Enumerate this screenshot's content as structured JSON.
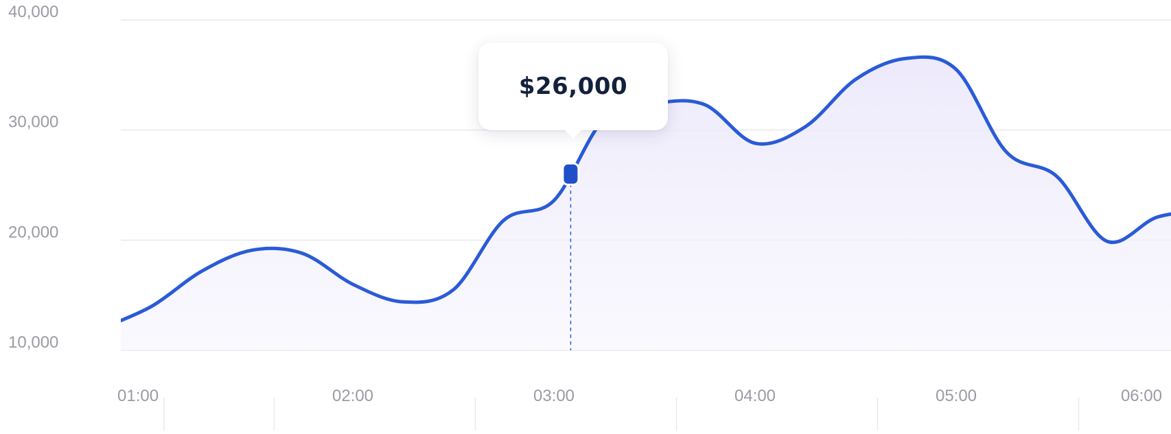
{
  "chart_data": {
    "type": "area",
    "x": [
      "00:45",
      "01:00",
      "01:15",
      "01:30",
      "01:45",
      "02:00",
      "02:15",
      "02:30",
      "02:45",
      "03:00",
      "03:15",
      "03:30",
      "03:45",
      "04:00",
      "04:15",
      "04:30",
      "04:45",
      "05:00",
      "05:15",
      "05:30",
      "05:45",
      "06:00",
      "06:15"
    ],
    "series": [
      {
        "values": [
          12000,
          14000,
          17200,
          19100,
          18800,
          16000,
          14400,
          15500,
          21800,
          23600,
          31000,
          32400,
          32300,
          28800,
          30300,
          34600,
          36500,
          35500,
          28000,
          25800,
          19900,
          22100,
          22700
        ],
        "color": "#2a5bd7"
      }
    ],
    "x_ticks": [
      "01:00",
      "02:00",
      "03:00",
      "04:00",
      "05:00",
      "06:00"
    ],
    "y_ticks": [
      "10,000",
      "20,000",
      "30,000",
      "40,000"
    ],
    "ylim": [
      10000,
      40000
    ],
    "grid": "horizontal",
    "highlight": {
      "x": "03:05",
      "value": 26000,
      "label": "$26,000"
    },
    "line_color": "#2a5bd7",
    "fill_color": "#efecfb",
    "grid_color": "#e9e9ee"
  }
}
